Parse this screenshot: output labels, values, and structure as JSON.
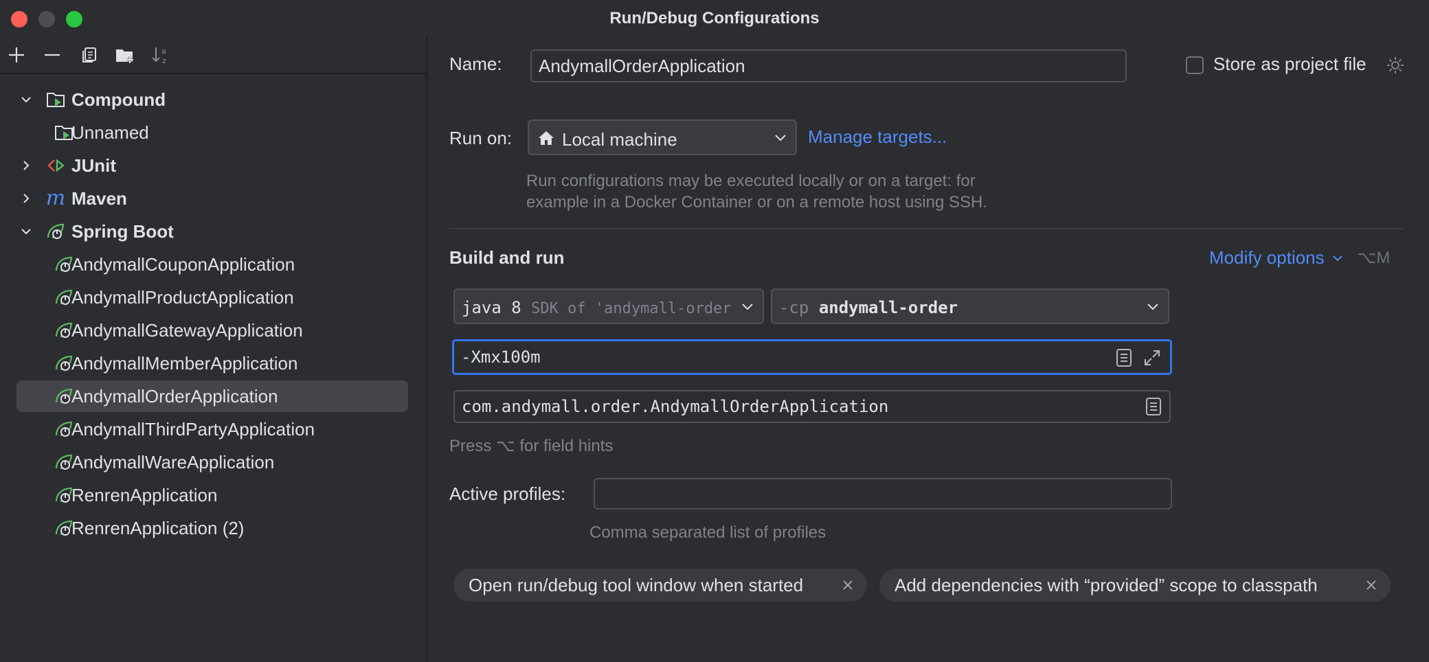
{
  "window": {
    "title": "Run/Debug Configurations"
  },
  "tree": {
    "compound": {
      "label": "Compound",
      "children": [
        "Unnamed"
      ]
    },
    "junit": {
      "label": "JUnit"
    },
    "maven": {
      "label": "Maven"
    },
    "spring_boot": {
      "label": "Spring Boot",
      "children": [
        "AndymallCouponApplication",
        "AndymallProductApplication",
        "AndymallGatewayApplication",
        "AndymallMemberApplication",
        "AndymallOrderApplication",
        "AndymallThirdPartyApplication",
        "AndymallWareApplication",
        "RenrenApplication",
        "RenrenApplication (2)"
      ],
      "selected": "AndymallOrderApplication"
    }
  },
  "form": {
    "name_label": "Name:",
    "name_value": "AndymallOrderApplication",
    "store_label": "Store as project file",
    "run_on_label": "Run on:",
    "run_on_value": "Local machine",
    "manage_targets": "Manage targets...",
    "run_on_hint_1": "Run configurations may be executed locally or on a target: for",
    "run_on_hint_2": "example in a Docker Container or on a remote host using SSH.",
    "build_run_title": "Build and run",
    "modify_options": "Modify options",
    "modify_shortcut": "⌥M",
    "jdk_main": "java 8",
    "jdk_detail": "SDK of 'andymall-order' modu",
    "cp_prefix": "-cp",
    "cp_value": "andymall-order",
    "vm_options": "-Xmx100m",
    "main_class": "com.andymall.order.AndymallOrderApplication",
    "field_hint": "Press ⌥ for field hints",
    "active_profiles_label": "Active profiles:",
    "active_profiles_value": "",
    "active_profiles_hint": "Comma separated list of profiles",
    "chips": [
      "Open run/debug tool window when started",
      "Add dependencies with “provided” scope to classpath"
    ]
  },
  "colors": {
    "accent": "#548af7",
    "spring": "#5fb865",
    "focus": "#3574f0"
  }
}
